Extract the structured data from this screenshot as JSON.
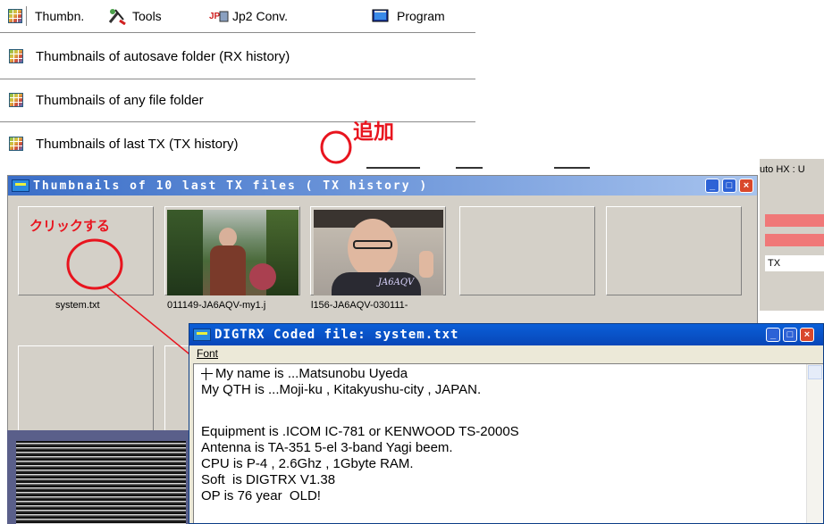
{
  "toolbar": {
    "items": [
      {
        "label": "Thumbn.",
        "icon": "grid-icon"
      },
      {
        "label": "Tools",
        "icon": "tools-icon"
      },
      {
        "label": "Jp2 Conv.",
        "icon": "jp2-icon"
      },
      {
        "label": "Program",
        "icon": "program-icon"
      }
    ]
  },
  "menu": {
    "items": [
      {
        "label": "Thumbnails of autosave folder  (RX history)"
      },
      {
        "label": "Thumbnails of any file folder"
      },
      {
        "label": "Thumbnails of last TX  (TX history)"
      }
    ]
  },
  "annotations": {
    "added": "追加",
    "click": "クリックする"
  },
  "background_app": {
    "line1": "uto HX : U",
    "tx": "TX"
  },
  "thumb_window": {
    "title": "Thumbnails of 10 last TX files     ( TX history )",
    "tiles": [
      {
        "label": "system.txt"
      },
      {
        "label": "011149-JA6AQV-my1.j"
      },
      {
        "label": "l156-JA6AQV-030111-"
      },
      {
        "label": ""
      },
      {
        "label": ""
      }
    ],
    "photo2_caption": "JA6AQV"
  },
  "digtrx_window": {
    "title": "DIGTRX   Coded file: system.txt",
    "menu_font": "Font",
    "lines": [
      "My name is ...Matsunobu Uyeda",
      "My QTH is ...Moji-ku , Kitakyushu-city , JAPAN.",
      "",
      "Equipment is .ICOM IC-781 or KENWOOD TS-2000S",
      "Antenna is TA-351 5-el 3-band Yagi beem.",
      "CPU is P-4 , 2.6Ghz , 1Gbyte RAM.",
      "Soft  is DIGTRX V1.38",
      "OP is 76 year  OLD!"
    ]
  },
  "colors": {
    "annotation_red": "#e8141e",
    "xp_title_blue": "#0a5fd8",
    "pink_bar": "#f07878"
  }
}
